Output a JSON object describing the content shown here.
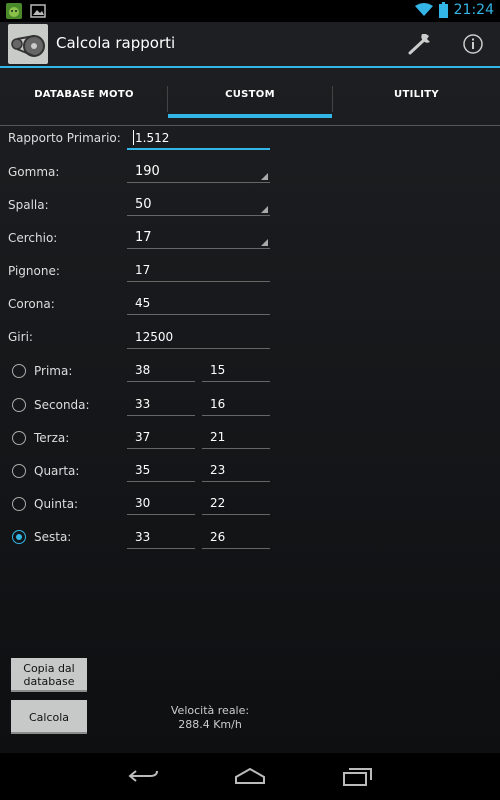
{
  "status_bar": {
    "time": "21:24"
  },
  "app": {
    "title": "Calcola rapporti"
  },
  "tabs": [
    {
      "label": "DATABASE MOTO",
      "active": false
    },
    {
      "label": "CUSTOM",
      "active": true
    },
    {
      "label": "UTILITY",
      "active": false
    }
  ],
  "fields": {
    "rapporto_primario": {
      "label": "Rapporto Primario:",
      "value": "1.512"
    },
    "gomma": {
      "label": "Gomma:",
      "value": "190"
    },
    "spalla": {
      "label": "Spalla:",
      "value": "50"
    },
    "cerchio": {
      "label": "Cerchio:",
      "value": "17"
    },
    "pignone": {
      "label": "Pignone:",
      "value": "17"
    },
    "corona": {
      "label": "Corona:",
      "value": "45"
    },
    "giri": {
      "label": "Giri:",
      "value": "12500"
    }
  },
  "gears": [
    {
      "label": "Prima:",
      "a": "38",
      "b": "15",
      "selected": false
    },
    {
      "label": "Seconda:",
      "a": "33",
      "b": "16",
      "selected": false
    },
    {
      "label": "Terza:",
      "a": "37",
      "b": "21",
      "selected": false
    },
    {
      "label": "Quarta:",
      "a": "35",
      "b": "23",
      "selected": false
    },
    {
      "label": "Quinta:",
      "a": "30",
      "b": "22",
      "selected": false
    },
    {
      "label": "Sesta:",
      "a": "33",
      "b": "26",
      "selected": true
    }
  ],
  "buttons": {
    "copy": "Copia dal database",
    "calc": "Calcola"
  },
  "result": {
    "label": "Velocità reale:",
    "value": "288.4 Km/h"
  },
  "colors": {
    "accent": "#33b5e5",
    "button": "#c7c8c8"
  }
}
